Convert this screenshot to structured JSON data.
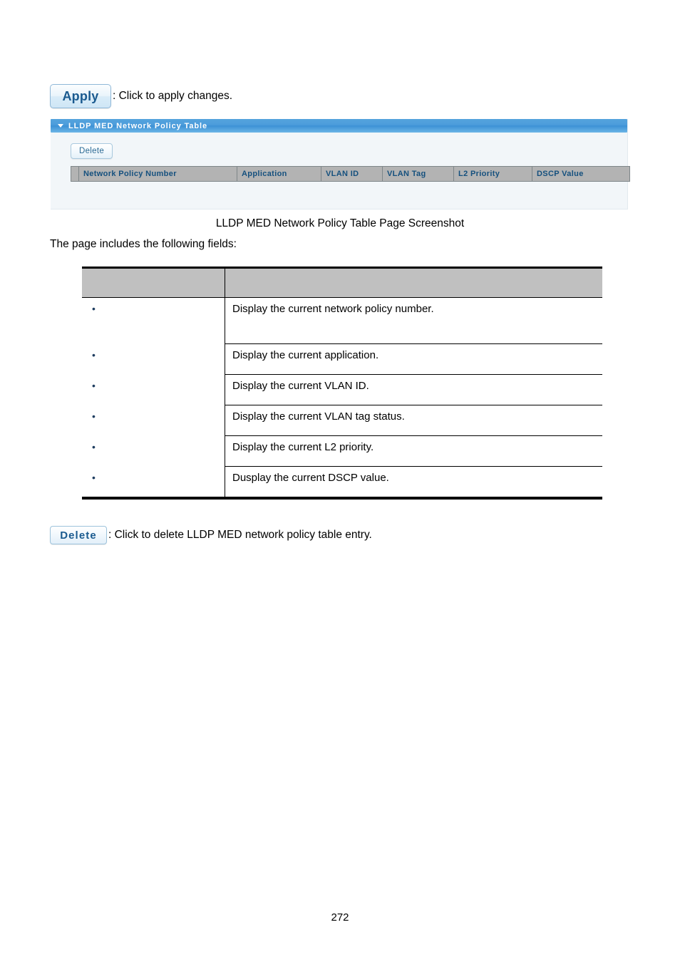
{
  "document": {
    "page_number": "272",
    "intro_text": "The page includes the following fields:",
    "figure_caption": "LLDP MED Network Policy Table Page Screenshot"
  },
  "apply_note": {
    "button_label": "Apply",
    "description": ": Click to apply changes."
  },
  "delete_note": {
    "button_label": "Delete",
    "description": ": Click to delete LLDP MED network policy table entry."
  },
  "screenshot": {
    "panel_title": "LLDP MED Network Policy Table",
    "delete_button_label": "Delete",
    "table_headers": [
      "Network Policy Number",
      "Application",
      "VLAN ID",
      "VLAN Tag",
      "L2 Priority",
      "DSCP Value"
    ],
    "rows": [],
    "colors": {
      "titlebar_blue": "#4d9ddb",
      "header_gray": "#b3b3b3",
      "header_text_blue": "#15507e",
      "panel_background": "#f2f6f9"
    }
  },
  "field_table": {
    "header": {
      "object": "",
      "description": ""
    },
    "rows": [
      {
        "object": "",
        "description": "Display the current network policy number."
      },
      {
        "object": "",
        "description": "Display the current application."
      },
      {
        "object": "",
        "description": "Display the current VLAN ID."
      },
      {
        "object": "",
        "description": "Display the current VLAN tag status."
      },
      {
        "object": "",
        "description": "Display the current L2 priority."
      },
      {
        "object": "",
        "description": "Dusplay the current DSCP value."
      }
    ]
  }
}
